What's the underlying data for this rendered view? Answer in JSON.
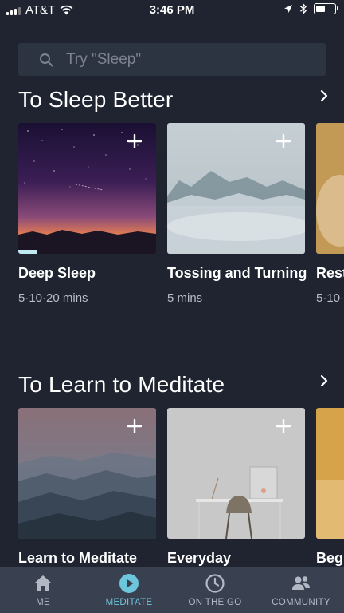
{
  "status": {
    "carrier": "AT&T",
    "time": "3:46 PM"
  },
  "search": {
    "placeholder": "Try \"Sleep\""
  },
  "sections": [
    {
      "title": "To Sleep Better",
      "cards": [
        {
          "title": "Deep Sleep",
          "subtitle": "5·10·20 mins",
          "progress": 0.14
        },
        {
          "title": "Tossing and Turning",
          "subtitle": "5 mins"
        },
        {
          "title": "Rest",
          "subtitle": "5·10·"
        }
      ]
    },
    {
      "title": "To Learn to Meditate",
      "cards": [
        {
          "title": "Learn to Meditate"
        },
        {
          "title": "Everyday"
        },
        {
          "title": "Beg"
        }
      ]
    }
  ],
  "tabbar": {
    "tabs": [
      {
        "label": "ME",
        "icon": "home-icon"
      },
      {
        "label": "MEDITATE",
        "icon": "play-icon",
        "active": true
      },
      {
        "label": "ON THE GO",
        "icon": "clock-icon"
      },
      {
        "label": "COMMUNITY",
        "icon": "people-icon"
      }
    ]
  },
  "colors": {
    "background": "#1f2430",
    "tabbar": "#394150",
    "accent": "#6ec6dc"
  }
}
